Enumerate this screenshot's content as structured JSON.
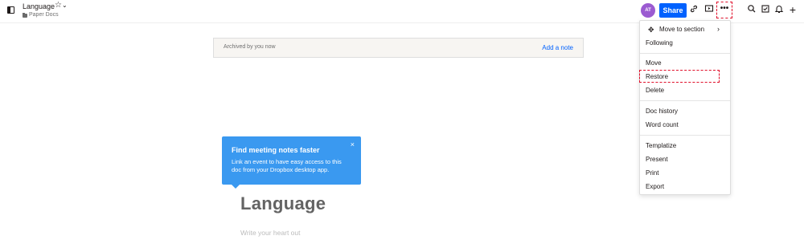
{
  "header": {
    "doc_title": "Language",
    "breadcrumb": "Paper Docs",
    "avatar_initials": "AT",
    "avatar_color": "#9b5bd1",
    "share_label": "Share",
    "share_color": "#0061fe",
    "more_label": "•••",
    "icons": [
      "sidebar-icon",
      "star-icon",
      "chevron-down-icon",
      "folder-icon",
      "link-icon",
      "present-icon",
      "more-icon",
      "search-icon",
      "checkbox-icon",
      "bell-icon",
      "plus-icon"
    ]
  },
  "banner": {
    "text": "Archived by you now",
    "add_note": "Add a note"
  },
  "tooltip": {
    "title": "Find meeting notes faster",
    "body": "Link an event to have easy access to this doc from your Dropbox desktop app.",
    "close": "×"
  },
  "document": {
    "heading": "Language",
    "placeholder": "Write your heart out"
  },
  "menu": {
    "move_to_section": "Move to section",
    "following": "Following",
    "move": "Move",
    "restore": "Restore",
    "delete": "Delete",
    "doc_history": "Doc history",
    "word_count": "Word count",
    "templatize": "Templatize",
    "present": "Present",
    "print": "Print",
    "export": "Export"
  }
}
